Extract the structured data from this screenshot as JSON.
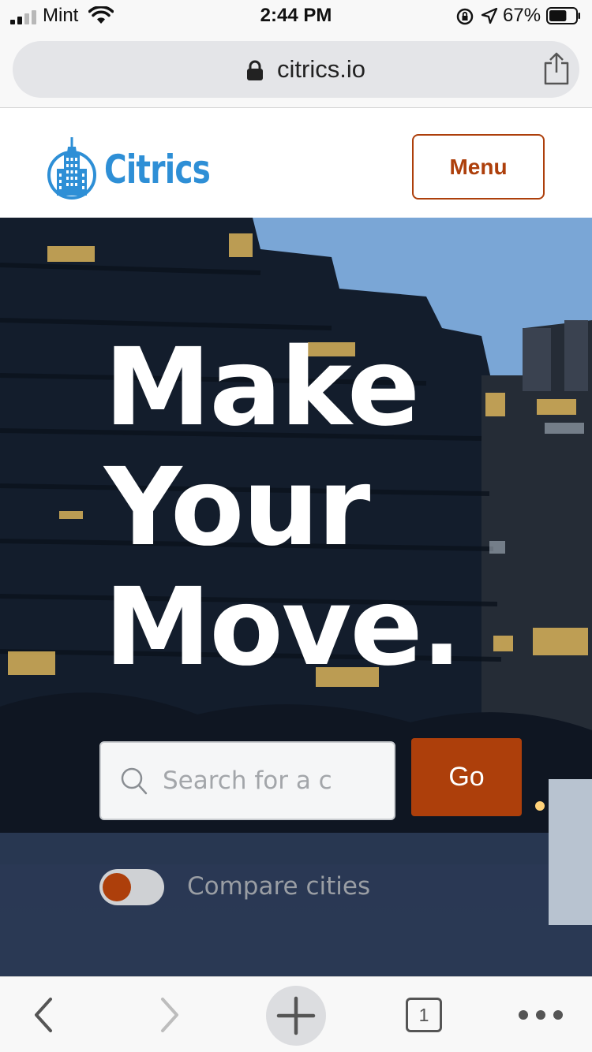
{
  "status_bar": {
    "carrier": "Mint",
    "time": "2:44 PM",
    "battery_percent": "67%",
    "battery_level": 0.67,
    "icons": [
      "signal-icon",
      "wifi-icon",
      "rotation-lock-icon",
      "location-icon",
      "battery-icon"
    ]
  },
  "browser": {
    "url": "citrics.io",
    "tab_count": "1",
    "toolbar_icons": [
      "back-icon",
      "forward-icon",
      "new-tab-icon",
      "tabs-icon",
      "more-icon"
    ]
  },
  "header": {
    "logo_text": "Citrics",
    "menu_label": "Menu"
  },
  "hero": {
    "headline": [
      "Make",
      "Your",
      "Move."
    ],
    "search_placeholder": "Search for a city",
    "go_label": "Go",
    "compare_label": "Compare cities",
    "compare_enabled": false
  },
  "colors": {
    "accent": "#ad3f0b",
    "logo_blue": "#2e8fd6",
    "hero_text": "#ffffff"
  }
}
